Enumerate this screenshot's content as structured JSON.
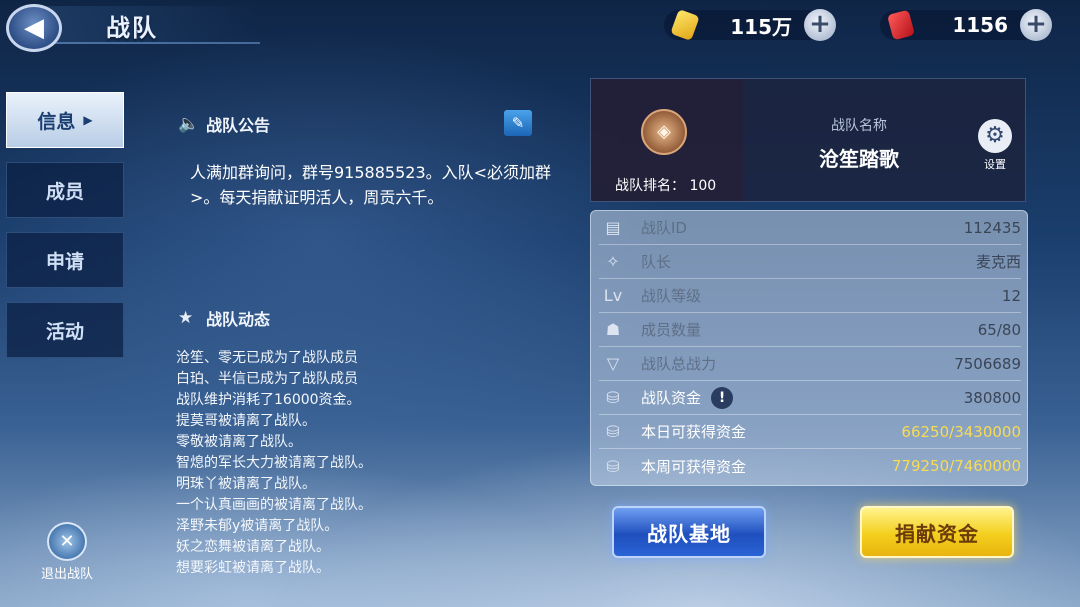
{
  "header": {
    "title": "战队",
    "back_icon": "back-arrow-icon",
    "currencies": [
      {
        "icon": "gold-coin-icon",
        "value": "115万"
      },
      {
        "icon": "red-gem-icon",
        "value": "1156"
      }
    ]
  },
  "tabs": [
    {
      "label": "信息",
      "active": true
    },
    {
      "label": "成员",
      "active": false
    },
    {
      "label": "申请",
      "active": false
    },
    {
      "label": "活动",
      "active": false
    }
  ],
  "exit": {
    "label": "退出战队"
  },
  "announcement": {
    "title": "战队公告",
    "text": "人满加群询问，群号915885523。入队<必须加群>。每天捐献证明活人，周贡六千。"
  },
  "activity": {
    "title": "战队动态",
    "entries": [
      "沧笙、零无已成为了战队成员",
      "白珀、半信已成为了战队成员",
      "战队维护消耗了16000资金。",
      "提莫哥被请离了战队。",
      "零敬被请离了战队。",
      "智熄的军长大力被请离了战队。",
      "明珠丫被请离了战队。",
      "一个认真画画的被请离了战队。",
      "泽野未郁y被请离了战队。",
      "妖之恋舞被请离了战队。",
      "想要彩虹被请离了战队。"
    ]
  },
  "team": {
    "rank_label": "战队排名：",
    "rank_value": "100",
    "name_caption": "战队名称",
    "name": "沧笙踏歌",
    "settings_label": "设置"
  },
  "stats": [
    {
      "icon": "id-card-icon",
      "label": "战队ID",
      "value": "112435"
    },
    {
      "icon": "wings-badge-icon",
      "label": "队长",
      "value": "麦克西"
    },
    {
      "icon": "level-icon",
      "label": "战队等级",
      "value": "12"
    },
    {
      "icon": "members-icon",
      "label": "成员数量",
      "value": "65/80"
    },
    {
      "icon": "power-icon",
      "label": "战队总战力",
      "value": "7506689"
    },
    {
      "icon": "coins-icon",
      "label": "战队资金",
      "value": "380800"
    },
    {
      "icon": "coins-icon",
      "label": "本日可获得资金",
      "value": "66250/3430000"
    },
    {
      "icon": "coins-icon",
      "label": "本周可获得资金",
      "value": "779250/7460000"
    }
  ],
  "buttons": {
    "base": "战队基地",
    "donate": "捐献资金"
  },
  "colors": {
    "gold_value": "#f7dc52",
    "base_button": "#2a63d6",
    "donate_button": "#f4cf1e"
  }
}
